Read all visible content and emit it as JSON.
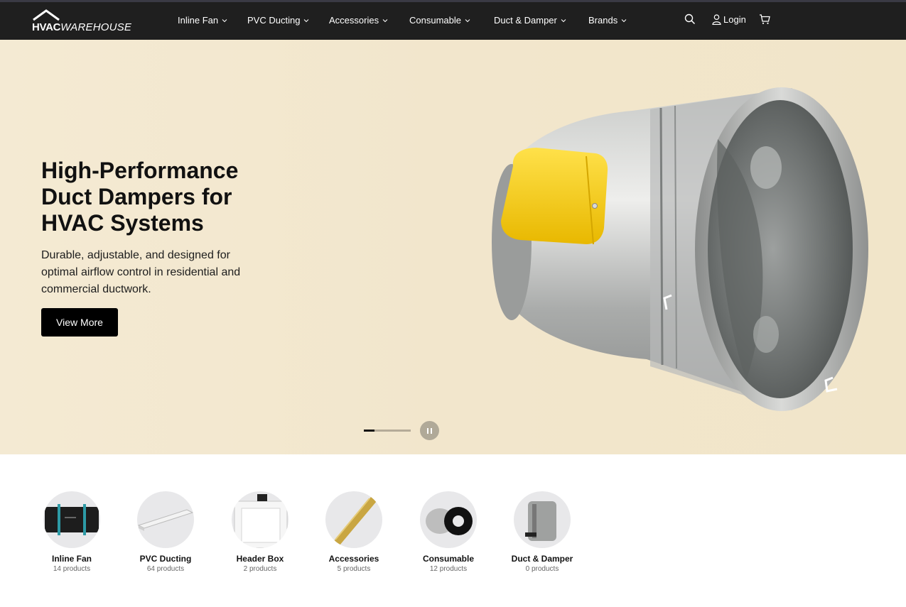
{
  "brand": {
    "logo_bold": "HVAC",
    "logo_italic": "WAREHOUSE"
  },
  "nav": {
    "items": [
      {
        "label": "Inline Fan"
      },
      {
        "label": "PVC Ducting"
      },
      {
        "label": "Accessories"
      },
      {
        "label": "Consumable"
      },
      {
        "label": "Duct & Damper"
      },
      {
        "label": "Brands"
      }
    ],
    "login_label": "Login"
  },
  "hero": {
    "title": "High-Performance Duct Dampers for HVAC Systems",
    "subtitle": "Durable, adjustable, and designed for optimal airflow control in residential and commercial ductwork.",
    "button_label": "View More",
    "slide_progress": 0.23
  },
  "categories": [
    {
      "name": "Inline Fan",
      "count": "14 products"
    },
    {
      "name": "PVC Ducting",
      "count": "64 products"
    },
    {
      "name": "Header Box",
      "count": "2 products"
    },
    {
      "name": "Accessories",
      "count": "5 products"
    },
    {
      "name": "Consumable",
      "count": "12 products"
    },
    {
      "name": "Duct & Damper",
      "count": "0 products"
    }
  ],
  "colors": {
    "header_bg": "#1f1f1f",
    "hero_bg": "#f3e8cf",
    "button_bg": "#000000",
    "damper_handle": "#f5cf17"
  }
}
